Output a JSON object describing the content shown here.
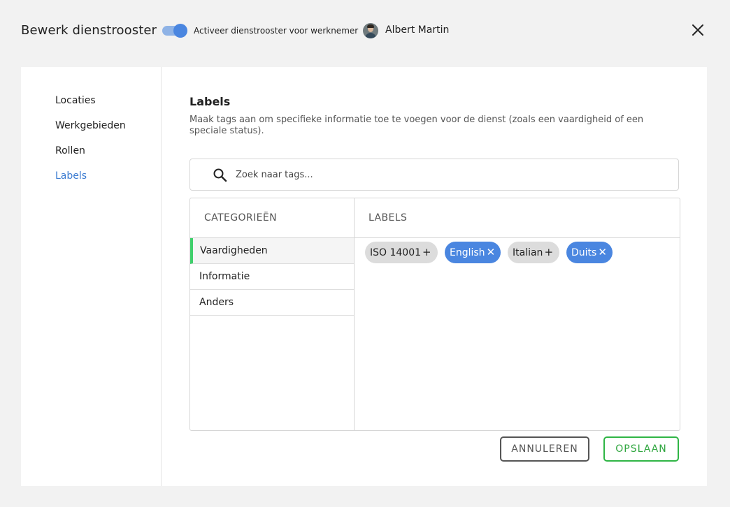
{
  "header": {
    "title": "Bewerk dienstrooster",
    "toggle_label": "Activeer dienstrooster voor werknemer",
    "toggle_on": true,
    "user_name": "Albert Martin",
    "close_icon": "close-icon"
  },
  "sidebar": {
    "items": [
      {
        "label": "Locaties",
        "active": false
      },
      {
        "label": "Werkgebieden",
        "active": false
      },
      {
        "label": "Rollen",
        "active": false
      },
      {
        "label": "Labels",
        "active": true
      }
    ]
  },
  "section": {
    "title": "Labels",
    "description": "Maak tags aan om specifieke informatie toe te voegen voor de dienst (zoals een vaardigheid of een speciale status)."
  },
  "search": {
    "placeholder": "Zoek naar tags...",
    "value": "",
    "icon": "search-icon"
  },
  "categories": {
    "header": "CATEGORIEËN",
    "items": [
      {
        "label": "Vaardigheden",
        "active": true
      },
      {
        "label": "Informatie",
        "active": false
      },
      {
        "label": "Anders",
        "active": false
      }
    ]
  },
  "labels": {
    "header": "LABELS",
    "tags": [
      {
        "label": "ISO 14001",
        "selected": false,
        "symbol": "+"
      },
      {
        "label": "English",
        "selected": true,
        "symbol": "✕"
      },
      {
        "label": "Italian",
        "selected": false,
        "symbol": "+"
      },
      {
        "label": "Duits",
        "selected": true,
        "symbol": "✕"
      }
    ]
  },
  "actions": {
    "cancel_label": "ANNULEREN",
    "save_label": "OPSLAAN"
  },
  "colors": {
    "accent_blue": "#4a86e0",
    "active_nav": "#3b7bd1",
    "save_green": "#2fb545",
    "category_marker": "#3fcf6b"
  }
}
